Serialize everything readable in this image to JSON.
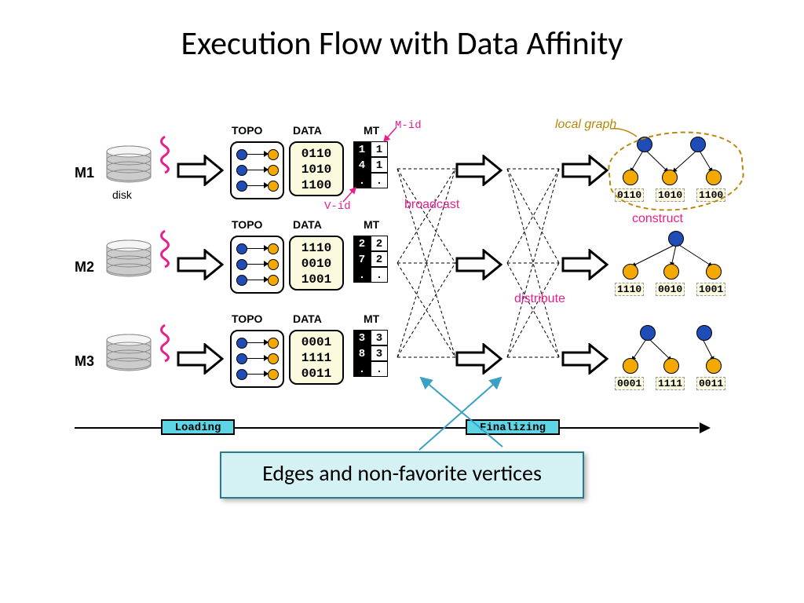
{
  "title": "Execution Flow with Data Affinity",
  "rows": [
    {
      "m": "M1",
      "disk_label": "disk",
      "data": [
        "0110",
        "1010",
        "1100"
      ],
      "mt": [
        [
          "1",
          "1"
        ],
        [
          "4",
          "1"
        ],
        [
          ".",
          "."
        ]
      ],
      "gd": [
        "0110",
        "1010",
        "1100"
      ]
    },
    {
      "m": "M2",
      "data": [
        "1110",
        "0010",
        "1001"
      ],
      "mt": [
        [
          "2",
          "2"
        ],
        [
          "7",
          "2"
        ],
        [
          ".",
          "."
        ]
      ],
      "gd": [
        "1110",
        "0010",
        "1001"
      ]
    },
    {
      "m": "M3",
      "data": [
        "0001",
        "1111",
        "0011"
      ],
      "mt": [
        [
          "3",
          "3"
        ],
        [
          "8",
          "3"
        ],
        [
          ".",
          "."
        ]
      ],
      "gd": [
        "0001",
        "1111",
        "0011"
      ]
    }
  ],
  "labels": {
    "topo": "TOPO",
    "data": "DATA",
    "mt": "MT",
    "mid": "M-id",
    "vid": "V-id",
    "broadcast": "broadcast",
    "distribute": "distribute",
    "construct": "construct",
    "localgraph": "local graph",
    "loading": "Loading",
    "finalizing": "Finalizing"
  },
  "callout": "Edges and non-favorite vertices"
}
